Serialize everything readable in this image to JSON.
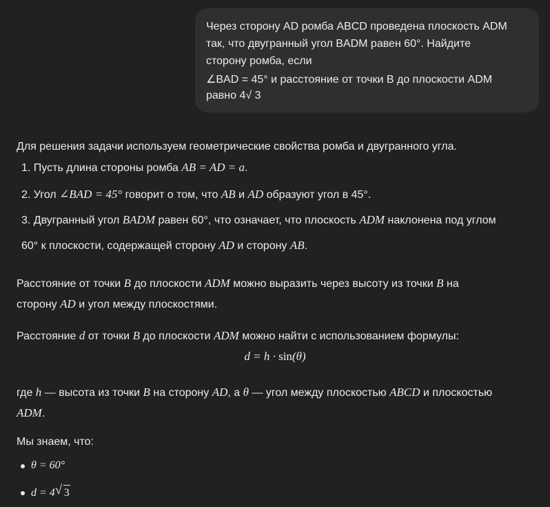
{
  "user_message": {
    "lines": [
      "Через сторону AD ромба ABCD проведена плоскость ADM",
      "так, что двугранный угол BADM равен 60°. Найдите",
      "сторону ромба, если",
      "∠BAD = 45° и расстояние от точки B до плоскости ADM",
      "равно 4√ 3"
    ]
  },
  "answer": {
    "intro": "Для решения задачи используем геометрические свойства ромба и двугранного угла.",
    "item1": {
      "num": "1.",
      "t1": "Пусть длина стороны ромба ",
      "m1": "AB = AD = a",
      "t2": "."
    },
    "item2": {
      "num": "2.",
      "t1": "Угол ",
      "m1": "∠BAD = 45°",
      "t2": " говорит о том, что ",
      "m2": "AB",
      "t3": " и ",
      "m3": "AD",
      "t4": " образуют угол в 45°."
    },
    "item3": {
      "num": "3.",
      "t1": "Двугранный угол ",
      "m1": "BADM",
      "t2": " равен 60°, что означает, что плоскость ",
      "m2": "ADM",
      "t3": " наклонена под углом"
    },
    "item3b": {
      "t1": "60° к плоскости, содержащей сторону ",
      "m1": "AD",
      "t2": " и сторону ",
      "m2": "AB",
      "t3": "."
    },
    "para1a": {
      "t1": "Расстояние от точки ",
      "m1": "B",
      "t2": " до плоскости ",
      "m2": "ADM",
      "t3": " можно выразить через высоту из точки ",
      "m3": "B",
      "t4": " на"
    },
    "para1b": {
      "t1": "сторону ",
      "m1": "AD",
      "t2": " и угол между плоскостями."
    },
    "para2": {
      "t1": "Расстояние ",
      "m1": "d",
      "t2": " от точки ",
      "m2": "B",
      "t3": " до плоскости ",
      "m3": "ADM",
      "t4": " можно найти с использованием формулы:"
    },
    "formula": {
      "lhs": "d = h · ",
      "fn": "sin",
      "arg": "(θ)"
    },
    "para3a": {
      "t1": "где ",
      "m1": "h",
      "t2": " — высота из точки ",
      "m2": "B",
      "t3": " на сторону ",
      "m3": "AD",
      "t4": ", а ",
      "m4": "θ",
      "t5": " — угол между плоскостью ",
      "m5": "ABCD",
      "t6": " и плоскостью"
    },
    "para3b": {
      "m1": "ADM",
      "t1": "."
    },
    "known": "Мы знаем, что:",
    "bullet1": "θ = 60°",
    "bullet2": {
      "lhs": "d = 4",
      "rad": "3"
    }
  }
}
